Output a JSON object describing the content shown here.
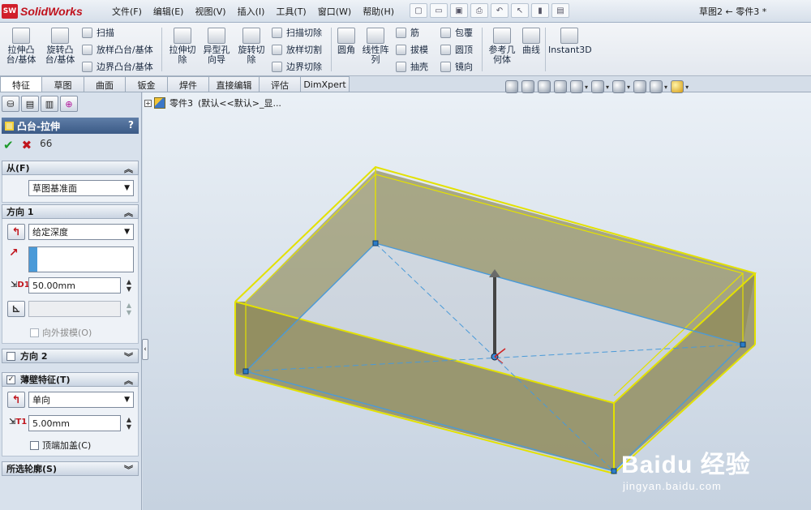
{
  "app": {
    "brand_badge": "SW",
    "brand_name": "SolidWorks",
    "document_title": "草图2 ← 零件3 *"
  },
  "menu": [
    "文件(F)",
    "编辑(E)",
    "视图(V)",
    "插入(I)",
    "工具(T)",
    "窗口(W)",
    "帮助(H)"
  ],
  "quick_icons": [
    "new-icon",
    "open-icon",
    "save-icon",
    "print-icon",
    "undo-icon",
    "select-icon",
    "rebuild-icon",
    "options-icon"
  ],
  "features": {
    "extrude_boss": "拉伸凸\n台/基体",
    "revolve_boss": "旋转凸\n台/基体",
    "sweep": "扫描",
    "loft": "放样凸台/基体",
    "boundary": "边界凸台/基体",
    "extrude_cut": "拉伸切\n除",
    "hole_wizard": "异型孔\n向导",
    "revolve_cut": "旋转切\n除",
    "sweep_cut": "扫描切除",
    "loft_cut": "放样切割",
    "boundary_cut": "边界切除",
    "fillet": "圆角",
    "linear_pattern": "线性阵\n列",
    "rib": "筋",
    "draft": "拔模",
    "shell": "抽壳",
    "wrap": "包覆",
    "dome": "圆顶",
    "mirror": "镜向",
    "ref_geometry": "参考几\n何体",
    "curves": "曲线",
    "instant3d": "Instant3D"
  },
  "tabs": [
    "特征",
    "草图",
    "曲面",
    "钣金",
    "焊件",
    "直接编辑",
    "评估",
    "DimXpert"
  ],
  "panel": {
    "title": "凸台-拉伸",
    "help": "?",
    "ok": "✔",
    "cancel": "✖",
    "preview": "66",
    "from": {
      "title": "从(F)",
      "value": "草图基准面"
    },
    "direction1": {
      "title": "方向 1",
      "end_condition": "给定深度",
      "depth": "50.00mm",
      "depth_label": "D1",
      "draft_outward": "向外拔模(O)"
    },
    "direction2": {
      "title": "方向 2"
    },
    "thin_feature": {
      "title": "薄壁特征(T)",
      "type": "单向",
      "thickness": "5.00mm",
      "thickness_label": "T1",
      "cap_ends": "顶端加盖(C)"
    },
    "selected_contours": {
      "title": "所选轮廓(S)"
    }
  },
  "tree": {
    "part": "零件3",
    "config": "(默认<<默认>_显..."
  },
  "watermark": {
    "brand": "Baidu",
    "service": "经验",
    "url": "jingyan.baidu.com"
  },
  "colors": {
    "accent": "#3b5a86",
    "model_face": "#8f8a58",
    "model_edge": "#e3e100",
    "sketch_line": "#4a9ad8",
    "cancel_red": "#c0151d",
    "ok_green": "#1d9a2a"
  }
}
